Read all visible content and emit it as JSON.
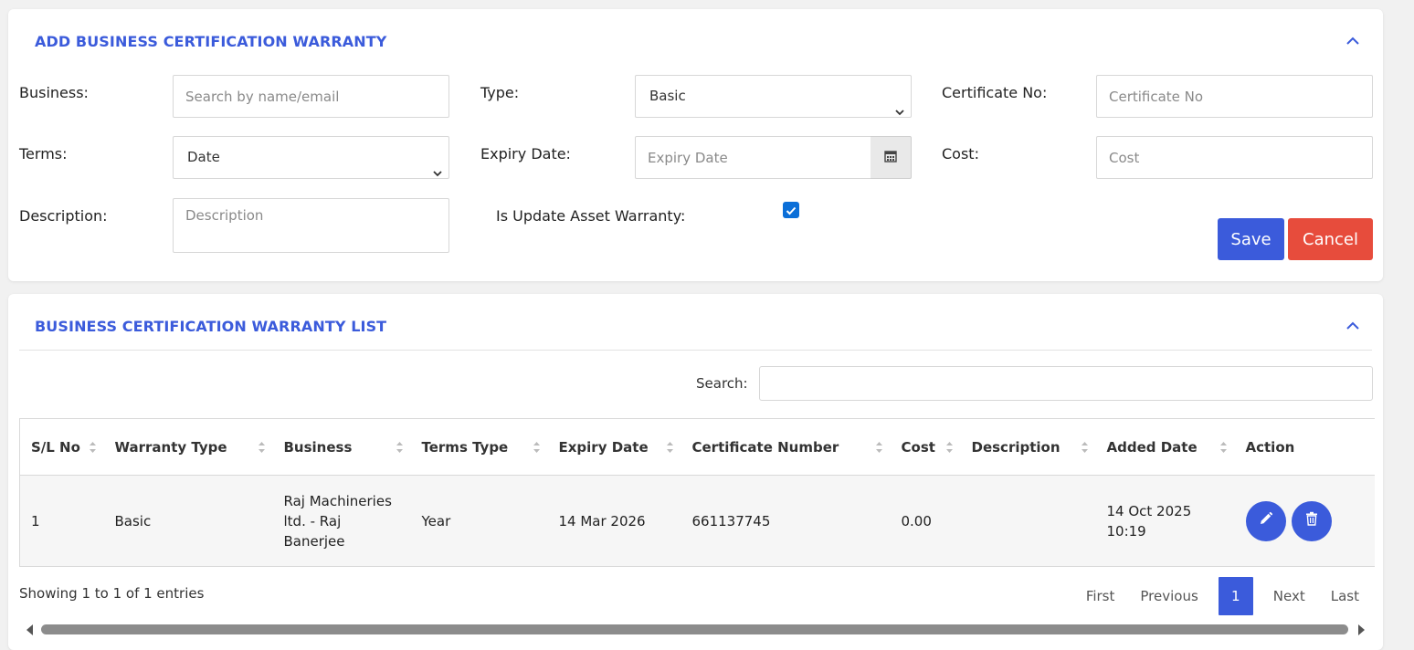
{
  "form": {
    "title": "ADD BUSINESS CERTIFICATION WARRANTY",
    "business": {
      "label": "Business:",
      "placeholder": "Search by name/email",
      "value": ""
    },
    "type": {
      "label": "Type:",
      "selected": "Basic"
    },
    "certificate_no": {
      "label": "Certificate No:",
      "placeholder": "Certificate No",
      "value": ""
    },
    "terms": {
      "label": "Terms:",
      "selected": "Date"
    },
    "expiry_date": {
      "label": "Expiry Date:",
      "placeholder": "Expiry Date",
      "value": ""
    },
    "cost": {
      "label": "Cost:",
      "placeholder": "Cost",
      "value": ""
    },
    "description": {
      "label": "Description:",
      "placeholder": "Description",
      "value": ""
    },
    "update_asset_warranty": {
      "label": "Is Update Asset Warranty:",
      "checked": true
    },
    "save_label": "Save",
    "cancel_label": "Cancel"
  },
  "list": {
    "title": "BUSINESS CERTIFICATION WARRANTY LIST",
    "search_label": "Search:",
    "columns": [
      "S/L No",
      "Warranty Type",
      "Business",
      "Terms Type",
      "Expiry Date",
      "Certificate Number",
      "Cost",
      "Description",
      "Added Date",
      "Action"
    ],
    "rows": [
      {
        "sl": "1",
        "warranty_type": "Basic",
        "business": "Raj Machineries ltd. - Raj Banerjee",
        "terms_type": "Year",
        "expiry_date": "14 Mar 2026",
        "certificate_number": "661137745",
        "cost": "0.00",
        "description": "",
        "added_date": "14 Oct 2025 10:19"
      }
    ],
    "info": "Showing 1 to 1 of 1 entries",
    "pagination": {
      "first": "First",
      "previous": "Previous",
      "current": "1",
      "next": "Next",
      "last": "Last"
    }
  },
  "colors": {
    "primary": "#3b5bdb",
    "danger": "#e74c3c",
    "checkbox": "#0b6fd8"
  }
}
